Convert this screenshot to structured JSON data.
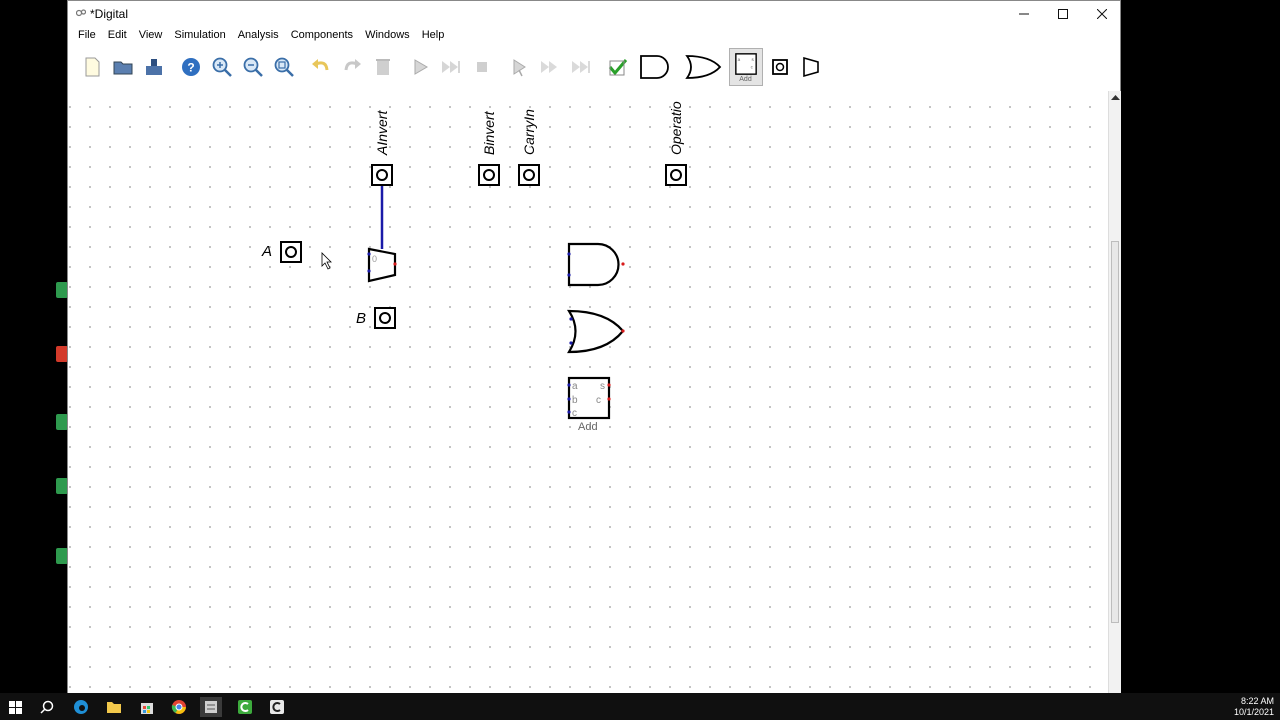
{
  "window": {
    "title": "*Digital"
  },
  "menu": [
    "File",
    "Edit",
    "View",
    "Simulation",
    "Analysis",
    "Components",
    "Windows",
    "Help"
  ],
  "toolbar": {
    "add_label": "Add"
  },
  "circuit": {
    "inputs": {
      "a_label": "A",
      "b_label": "B",
      "ainvert_label": "AInvert",
      "binvert_label": "Binvert",
      "carryin_label": "CarryIn",
      "operation_label": "Operatio"
    },
    "mux_sel_label": "0",
    "adder": {
      "label": "Add",
      "pin_a": "a",
      "pin_b": "b",
      "pin_c": "c",
      "pin_s": "s",
      "pin_co": "c"
    }
  },
  "taskbar": {
    "time": "8:22 AM",
    "date": "10/1/2021"
  },
  "colors": {
    "wire": "#1a1aa8",
    "pin_out": "#d81b1b",
    "pin_in": "#1a1aa8"
  }
}
